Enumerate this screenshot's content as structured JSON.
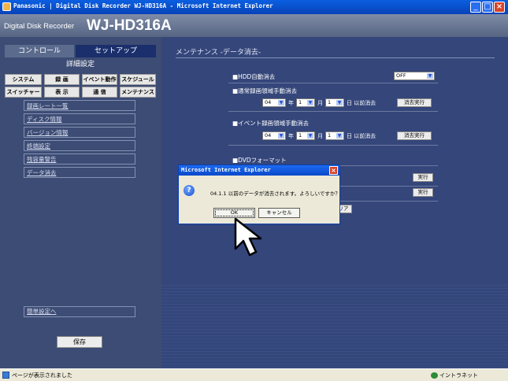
{
  "window": {
    "title": "Panasonic | Digital Disk Recorder WJ-HD316A - Microsoft Internet Explorer"
  },
  "header": {
    "product_small": "Digital Disk Recorder",
    "product_model": "WJ-HD316A"
  },
  "sidebar": {
    "tabs": [
      {
        "label": "コントロール"
      },
      {
        "label": "セットアップ"
      }
    ],
    "title": "詳細設定",
    "categories_row1": [
      "システム",
      "録 画",
      "イベント動作",
      "スケジュール"
    ],
    "categories_row2": [
      "スイッチャー",
      "表 示",
      "通 信",
      "メンテナンス"
    ],
    "menu_items": [
      "録画レート一覧",
      "ディスク情報",
      "バージョン情報",
      "終端設定",
      "残容量警告",
      "データ消去"
    ],
    "easy_setup_label": "簡単設定へ",
    "save_label": "保存"
  },
  "content": {
    "section_title": "メンテナンス -データ消去-",
    "hdd_auto_erase": {
      "label": "■HDD自動消去",
      "value": "OFF"
    },
    "normal_erase": {
      "label": "■通常録画領域手動消去",
      "year": "04",
      "year_unit": "年",
      "month": "1",
      "month_unit": "月",
      "day": "1",
      "day_unit": "日 以前消去",
      "button": "消去実行"
    },
    "event_erase": {
      "label": "■イベント録画領域手動消去",
      "year": "04",
      "year_unit": "年",
      "month": "1",
      "month_unit": "月",
      "day": "1",
      "day_unit": "日 以前消去",
      "button": "消去実行"
    },
    "dvd_format": {
      "label": "■DVDフォーマット"
    },
    "exec_button_1": "実行",
    "exec_button_2": "実行",
    "clear_button": "リア"
  },
  "dialog": {
    "title": "Microsoft Internet Explorer",
    "icon": "question-icon",
    "message": "04.1.1 以前のデータが消去されます。よろしいですか？",
    "ok_label": "OK",
    "cancel_label": "キャンセル"
  },
  "statusbar": {
    "text": "ページが表示されました",
    "zone": "イントラネット"
  },
  "colors": {
    "titlebar": "#0a5fe0",
    "panel_bg": "#2a3d73",
    "content_bg": "#34467a"
  }
}
